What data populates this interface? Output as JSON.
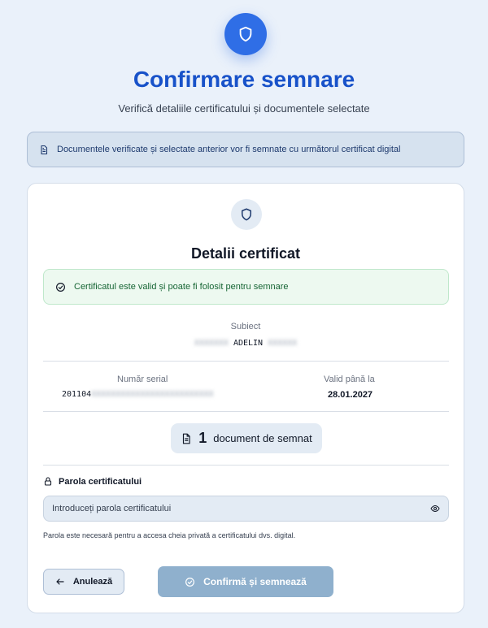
{
  "header": {
    "title": "Confirmare semnare",
    "subtitle": "Verifică detaliile certificatului și documentele selectate"
  },
  "banner": {
    "text": "Documentele verificate și selectate anterior vor fi semnate cu următorul certificat digital"
  },
  "certificate": {
    "title": "Detalii certificat",
    "valid_message": "Certificatul este valid și poate fi folosit pentru semnare",
    "subject_label": "Subiect",
    "subject_visible": "ADELIN",
    "serial_label": "Număr serial",
    "serial_visible": "201104",
    "valid_until_label": "Valid până la",
    "valid_until_value": "28.01.2027"
  },
  "documents": {
    "count": "1",
    "label": "document de semnat"
  },
  "password": {
    "label": "Parola certificatului",
    "placeholder": "Introduceți parola certificatului",
    "help": "Parola este necesară pentru a accesa cheia privată a certificatului dvs. digital."
  },
  "actions": {
    "cancel_label": "Anulează",
    "confirm_label": "Confirmă și semnează"
  },
  "colors": {
    "primary": "#2f6ee6",
    "title": "#1852c9",
    "success": "#166534",
    "confirm_disabled": "#8fb0cd"
  }
}
